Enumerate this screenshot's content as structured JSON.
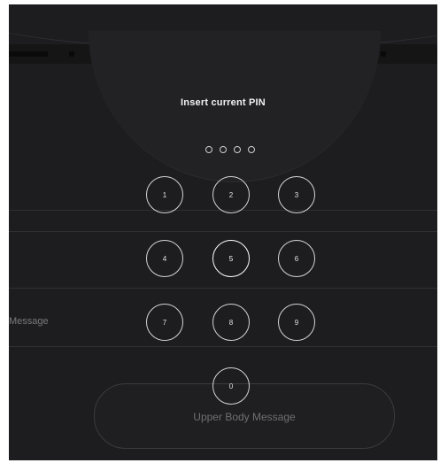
{
  "pin_prompt": {
    "title": "Insert current PIN",
    "dot_count": 4
  },
  "keypad": {
    "keys": [
      "1",
      "2",
      "3",
      "4",
      "5",
      "6",
      "7",
      "8",
      "9",
      "0"
    ]
  },
  "background": {
    "message_label": "Message",
    "upper_button_label": "Upper Body Message"
  },
  "colors": {
    "backdrop": "#1d1d1f",
    "key_border": "#d4d4d4",
    "text": "#f2f2f2"
  }
}
